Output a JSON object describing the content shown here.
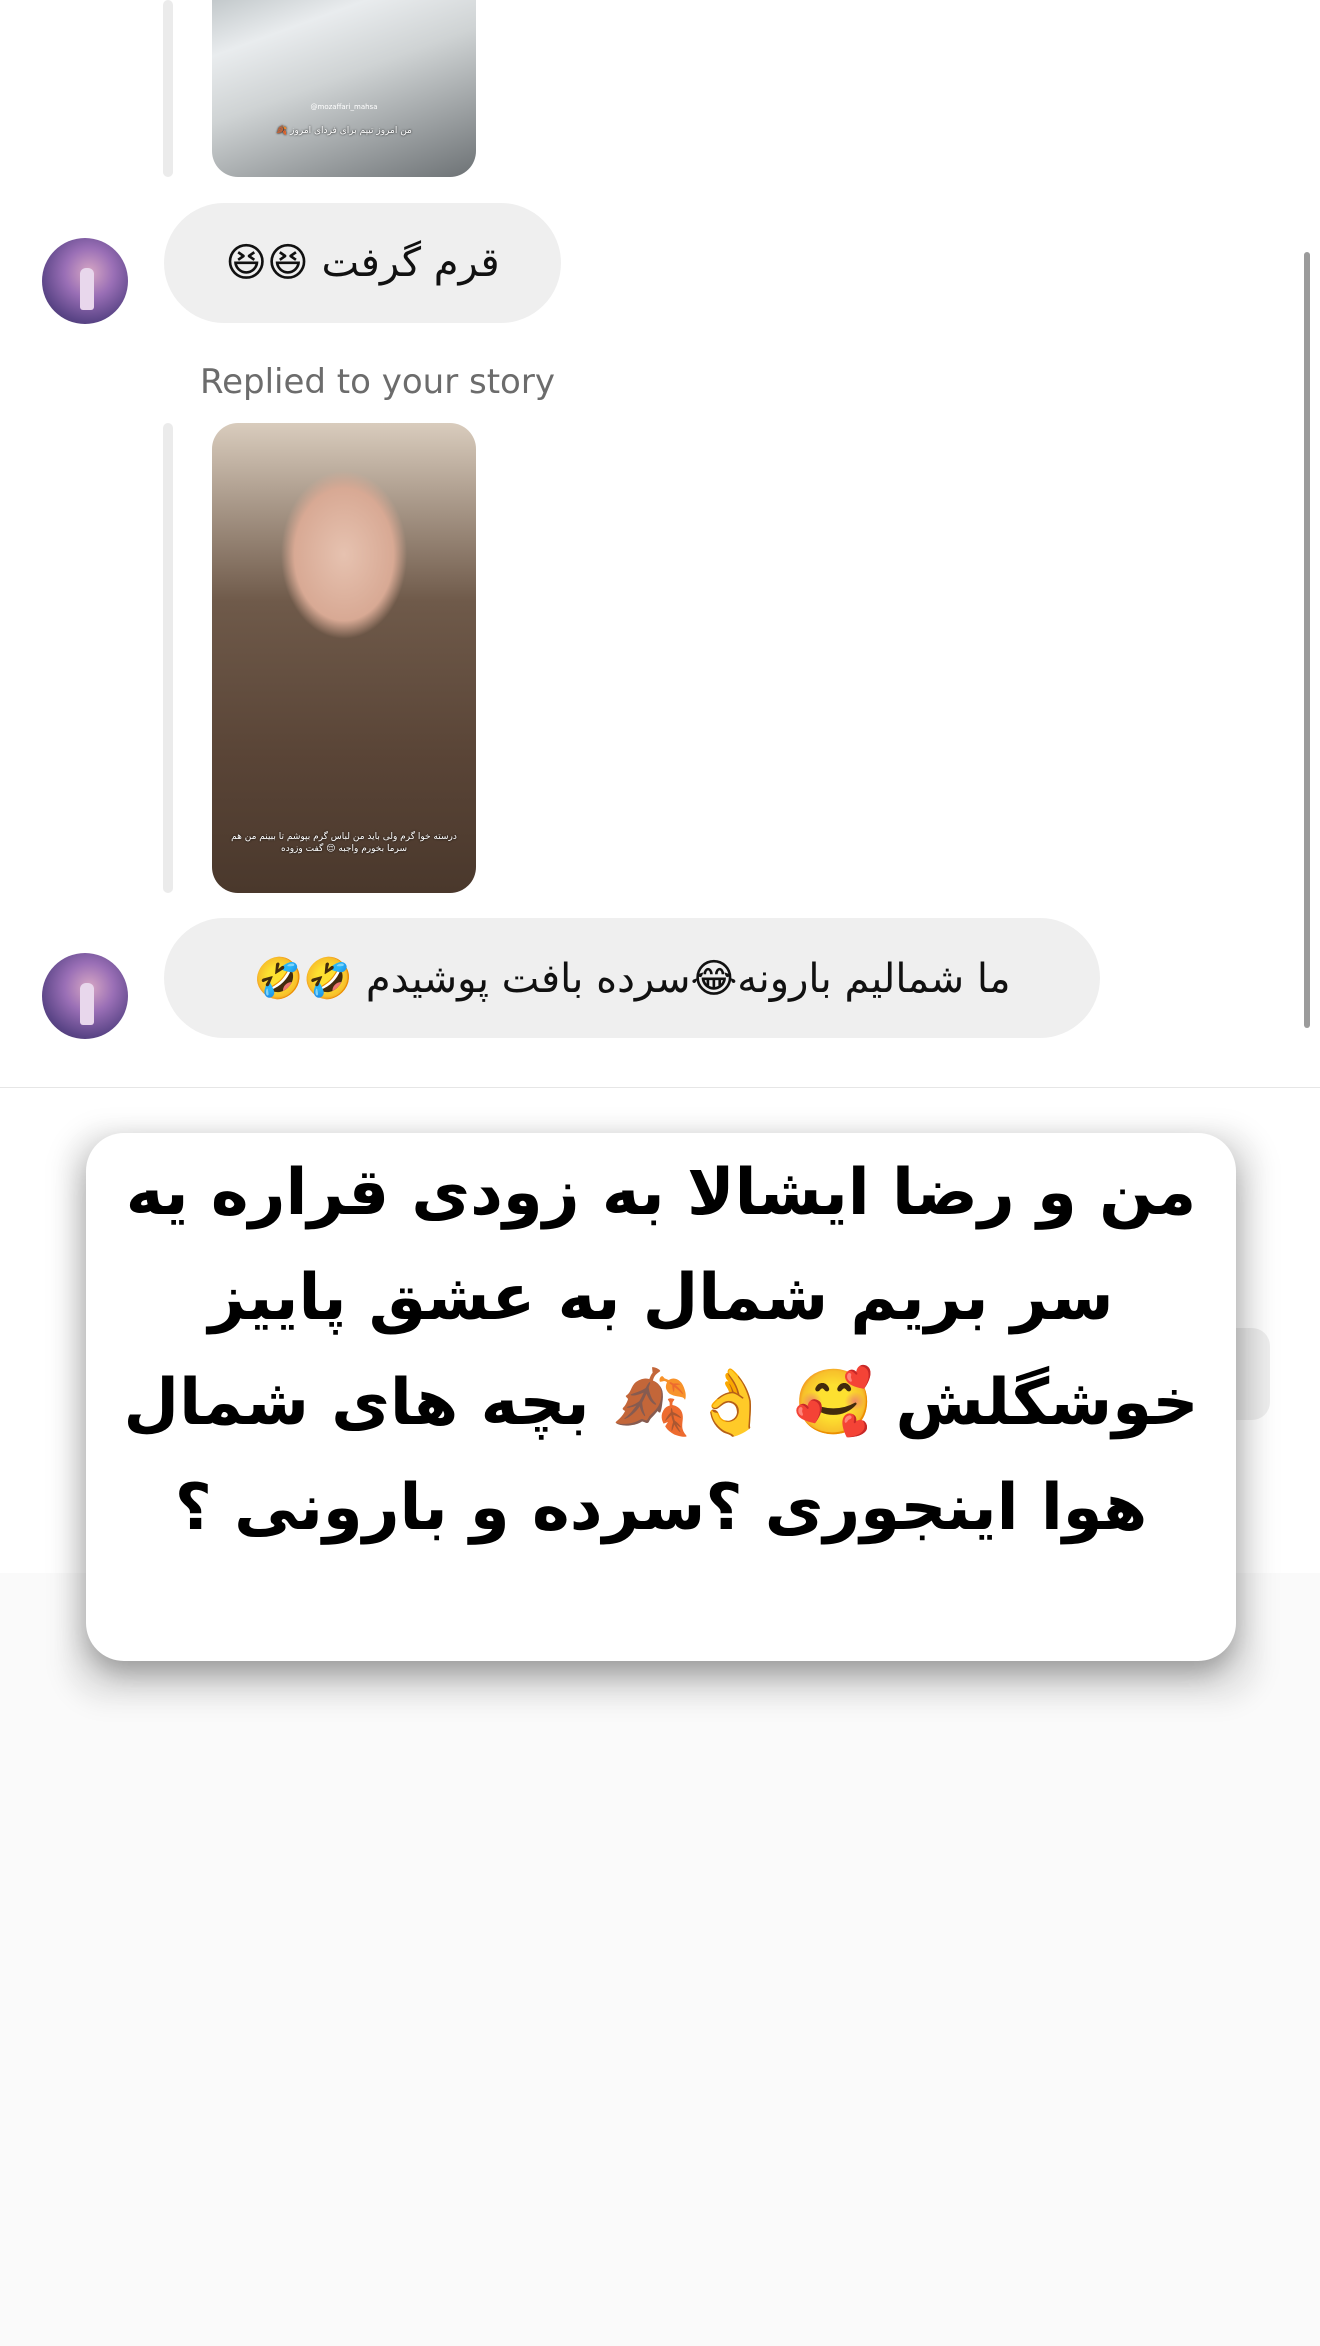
{
  "messages": [
    {
      "type": "story_reply_thumb",
      "caption": "من امروز تیپم برای فردای امروز 🍂",
      "handle": "@mozaffari_mahsa"
    },
    {
      "type": "text",
      "text": "قرم گرفت 😆😆"
    },
    {
      "type": "story_reply_label",
      "text": "Replied to your story"
    },
    {
      "type": "story_reply_thumb",
      "caption": "درسته خوا گرم ولی باید من لباس گرم بپوشم تا ببینم من هم سرما بخورم واجبه 😌 گفت وزوده"
    },
    {
      "type": "text",
      "text": "ما شمالیم بارونه😂سرده بافت پوشیدم 🤣🤣"
    }
  ],
  "overlay": {
    "text": "من و رضا ایشالا به زودی قراره یه سر بریم شمال به عشق پاییز خوشگلش 🥰 👌🍂 بچه های شمال هوا اینجوری ؟سرده و بارونی ؟"
  },
  "colors": {
    "bubble": "#efefef",
    "page_background": "#fafafa",
    "label_text": "#6c6c6c"
  }
}
